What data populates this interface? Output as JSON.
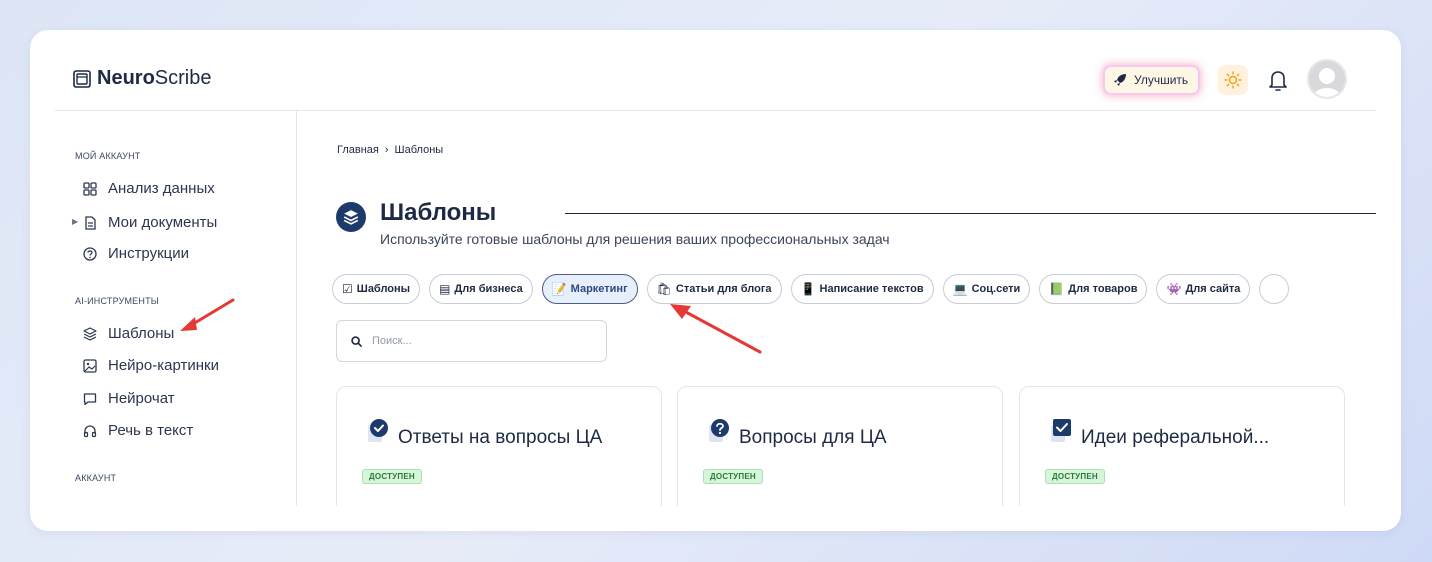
{
  "brand": {
    "name_bold": "Neuro",
    "name_light": "Scribe"
  },
  "header": {
    "upgrade_label": "Улучшить"
  },
  "sidebar": {
    "section_account": "МОЙ АККАУНТ",
    "items_account": [
      {
        "label": "Анализ данных",
        "icon": "grid-icon"
      },
      {
        "label": "Мои документы",
        "icon": "document-icon"
      },
      {
        "label": "Инструкции",
        "icon": "help-icon"
      }
    ],
    "section_ai": "AI-ИНСТРУМЕНТЫ",
    "items_ai": [
      {
        "label": "Шаблоны",
        "icon": "layers-icon"
      },
      {
        "label": "Нейро-картинки",
        "icon": "image-icon"
      },
      {
        "label": "Нейрочат",
        "icon": "chat-icon"
      },
      {
        "label": "Речь в текст",
        "icon": "headphones-icon"
      }
    ],
    "section_profile": "АККАУНТ"
  },
  "breadcrumb": {
    "home": "Главная",
    "separator": "›",
    "current": "Шаблоны"
  },
  "page": {
    "title": "Шаблоны",
    "subtitle": "Используйте готовые шаблоны для решения ваших профессиональных задач"
  },
  "chips": [
    {
      "icon": "☑",
      "label": "Шаблоны"
    },
    {
      "icon": "▤",
      "label": "Для бизнеса"
    },
    {
      "icon": "📝",
      "label": "Маркетинг",
      "active": true
    },
    {
      "icon": "🛍",
      "label": "Статьи для блога"
    },
    {
      "icon": "📱",
      "label": "Написание текстов"
    },
    {
      "icon": "💻",
      "label": "Соц.сети"
    },
    {
      "icon": "📗",
      "label": "Для товаров"
    },
    {
      "icon": "👾",
      "label": "Для сайта"
    }
  ],
  "search": {
    "placeholder": "Поиск..."
  },
  "cards": [
    {
      "title": "Ответы на вопросы ЦА",
      "badge": "ДОСТУПЕН",
      "icon": "check-circle-icon"
    },
    {
      "title": "Вопросы для ЦА",
      "badge": "ДОСТУПЕН",
      "icon": "question-circle-icon"
    },
    {
      "title": "Идеи реферальной...",
      "badge": "ДОСТУПЕН",
      "icon": "check-square-icon"
    }
  ],
  "colors": {
    "accent": "#1d3b6a",
    "annotation": "#e53935",
    "badge_bg": "#d7f5da",
    "badge_text": "#2b7a3b"
  }
}
